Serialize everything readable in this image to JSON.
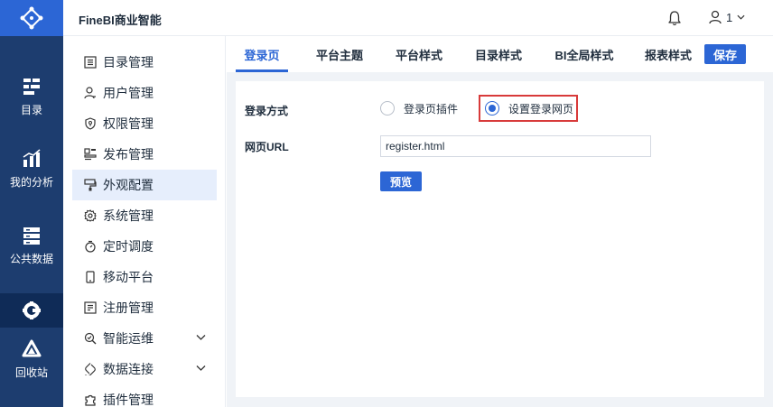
{
  "app": {
    "title": "FineBI商业智能"
  },
  "header": {
    "user_name": "1"
  },
  "rail": {
    "items": [
      {
        "label": "目录",
        "icon": "catalog-icon"
      },
      {
        "label": "我的分析",
        "icon": "chart-icon"
      },
      {
        "label": "公共数据",
        "icon": "database-icon"
      },
      {
        "label": "",
        "icon": "settings-icon",
        "active": true
      },
      {
        "label": "回收站",
        "icon": "recycle-icon"
      }
    ]
  },
  "menu": {
    "items": [
      {
        "label": "目录管理",
        "icon": "list-icon"
      },
      {
        "label": "用户管理",
        "icon": "user-icon"
      },
      {
        "label": "权限管理",
        "icon": "shield-icon"
      },
      {
        "label": "发布管理",
        "icon": "publish-icon"
      },
      {
        "label": "外观配置",
        "icon": "paint-icon",
        "active": true
      },
      {
        "label": "系统管理",
        "icon": "gear-icon"
      },
      {
        "label": "定时调度",
        "icon": "timer-icon"
      },
      {
        "label": "移动平台",
        "icon": "mobile-icon"
      },
      {
        "label": "注册管理",
        "icon": "register-icon"
      },
      {
        "label": "智能运维",
        "icon": "ops-icon",
        "expandable": true
      },
      {
        "label": "数据连接",
        "icon": "link-icon",
        "expandable": true
      },
      {
        "label": "插件管理",
        "icon": "plugin-icon"
      }
    ]
  },
  "tabs": [
    {
      "label": "登录页",
      "active": true
    },
    {
      "label": "平台主题"
    },
    {
      "label": "平台样式"
    },
    {
      "label": "目录样式"
    },
    {
      "label": "BI全局样式"
    },
    {
      "label": "报表样式"
    }
  ],
  "toolbar": {
    "save_label": "保存"
  },
  "form": {
    "login_method_label": "登录方式",
    "option_plugin": "登录页插件",
    "option_custom": "设置登录网页",
    "selected": "设置登录网页",
    "url_label": "网页URL",
    "url_value": "register.html",
    "preview_label": "预览"
  },
  "colors": {
    "accent": "#2c66d5",
    "rail": "#1d3d6f",
    "highlight": "#d83a3a"
  }
}
